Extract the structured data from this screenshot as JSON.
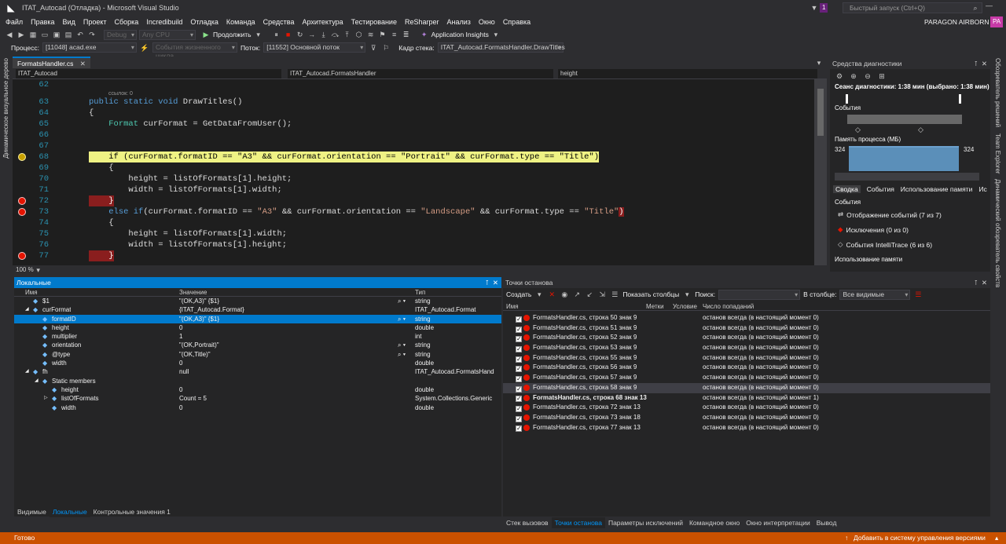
{
  "window": {
    "title": "ITAT_Autocad (Отладка) - Microsoft Visual Studio",
    "quick_launch": "Быстрый запуск (Ctrl+Q)",
    "user": "PARAGON AIRBORN",
    "user_initials": "PA",
    "notif_count": "1"
  },
  "menu": [
    "Файл",
    "Правка",
    "Вид",
    "Проект",
    "Сборка",
    "Incredibuild",
    "Отладка",
    "Команда",
    "Средства",
    "Архитектура",
    "Тестирование",
    "ReSharper",
    "Анализ",
    "Окно",
    "Справка"
  ],
  "toolbar": {
    "config": "Debug",
    "platform": "Any CPU",
    "continue": "Продолжить",
    "app_insights": "Application Insights"
  },
  "toolbar2": {
    "process_label": "Процесс:",
    "process": "[11048] acad.exe",
    "lifecycle": "События жизненного цикла",
    "thread_label": "Поток:",
    "thread": "[11552] Основной поток",
    "frame_label": "Кадр стека:",
    "frame": "ITAT_Autocad.FormatsHandler.DrawTitles"
  },
  "side_tabs": {
    "left": "Динамическое визуальное дерево",
    "right1": "Обозреватель решений",
    "right2": "Team Explorer",
    "right3": "Динамический обозреватель свойств"
  },
  "editor": {
    "tab": "FormatsHandler.cs",
    "nav_project": "ITAT_Autocad",
    "nav_class": "ITAT_Autocad.FormatsHandler",
    "nav_member": "height",
    "zoom": "100 %",
    "refs": "ссылок: 0",
    "lines": [
      {
        "n": "62",
        "code": ""
      },
      {
        "n": "63",
        "code": "public static void DrawTitles()"
      },
      {
        "n": "64",
        "code": "{"
      },
      {
        "n": "65",
        "code": "    Format curFormat = GetDataFromUser();"
      },
      {
        "n": "66",
        "code": ""
      },
      {
        "n": "67",
        "code": ""
      },
      {
        "n": "68",
        "code": "    if (curFormat.formatID == \"A3\" && curFormat.orientation == \"Portrait\" && curFormat.type == \"Title\")"
      },
      {
        "n": "69",
        "code": "    {"
      },
      {
        "n": "70",
        "code": "        height = listOfFormats[1].height;"
      },
      {
        "n": "71",
        "code": "        width = listOfFormats[1].width;"
      },
      {
        "n": "72",
        "code": "    }"
      },
      {
        "n": "73",
        "code": "    else if(curFormat.formatID == \"A3\" && curFormat.orientation == \"Landscape\" && curFormat.type == \"Title\")"
      },
      {
        "n": "74",
        "code": "    {"
      },
      {
        "n": "75",
        "code": "        height = listOfFormats[1].width;"
      },
      {
        "n": "76",
        "code": "        width = listOfFormats[1].height;"
      },
      {
        "n": "77",
        "code": "    }"
      }
    ]
  },
  "diagnostics": {
    "title": "Средства диагностики",
    "session": "Сеанс диагностики: 1:38 мин (выбрано: 1:38 мин)",
    "events": "События",
    "memory": "Память процесса (МБ)",
    "mem_left": "324",
    "mem_right": "324",
    "tabs": [
      "Сводка",
      "События",
      "Использование памяти",
      "Ис"
    ],
    "events_header": "События",
    "items": [
      "Отображение событий (7 из 7)",
      "Исключения (0 из 0)",
      "События IntelliTrace (6 из 6)"
    ],
    "memory_usage": "Использование памяти"
  },
  "locals": {
    "title": "Локальные",
    "headers": [
      "Имя",
      "Значение",
      "Тип"
    ],
    "rows": [
      {
        "name": "$1",
        "value": "\"(OK,A3)\" {$1}",
        "type": "string",
        "indent": 1
      },
      {
        "name": "curFormat",
        "value": "{ITAT_Autocad.Format}",
        "type": "ITAT_Autocad.Format",
        "indent": 1
      },
      {
        "name": "formatID",
        "value": "\"(OK,A3)\" {$1}",
        "type": "string",
        "indent": 2
      },
      {
        "name": "height",
        "value": "0",
        "type": "double",
        "indent": 2
      },
      {
        "name": "multiplier",
        "value": "1",
        "type": "int",
        "indent": 2
      },
      {
        "name": "orientation",
        "value": "\"(OK,Portrait)\"",
        "type": "string",
        "indent": 2
      },
      {
        "name": "@type",
        "value": "\"(OK,Title)\"",
        "type": "string",
        "indent": 2
      },
      {
        "name": "width",
        "value": "0",
        "type": "double",
        "indent": 2
      },
      {
        "name": "fh",
        "value": "null",
        "type": "ITAT_Autocad.FormatsHand",
        "indent": 1
      },
      {
        "name": "Static members",
        "value": "",
        "type": "",
        "indent": 2
      },
      {
        "name": "height",
        "value": "0",
        "type": "double",
        "indent": 3
      },
      {
        "name": "listOfFormats",
        "value": "Count = 5",
        "type": "System.Collections.Generic",
        "indent": 3
      },
      {
        "name": "width",
        "value": "0",
        "type": "double",
        "indent": 3
      }
    ],
    "bottom_tabs": [
      "Видимые",
      "Локальные",
      "Контрольные значения 1"
    ]
  },
  "breakpoints": {
    "title": "Точки останова",
    "create": "Создать",
    "show_columns": "Показать столбцы",
    "search": "Поиск:",
    "in_column": "В столбце:",
    "all_visible": "Все видимые",
    "headers": [
      "Имя",
      "Метки",
      "Условие",
      "Число попаданий"
    ],
    "rows": [
      {
        "name": "FormatsHandler.cs, строка 50 знак 9",
        "hits": "останов всегда  (в настоящий момент 0)"
      },
      {
        "name": "FormatsHandler.cs, строка 51 знак 9",
        "hits": "останов всегда  (в настоящий момент 0)"
      },
      {
        "name": "FormatsHandler.cs, строка 52 знак 9",
        "hits": "останов всегда  (в настоящий момент 0)"
      },
      {
        "name": "FormatsHandler.cs, строка 53 знак 9",
        "hits": "останов всегда  (в настоящий момент 0)"
      },
      {
        "name": "FormatsHandler.cs, строка 55 знак 9",
        "hits": "останов всегда  (в настоящий момент 0)"
      },
      {
        "name": "FormatsHandler.cs, строка 56 знак 9",
        "hits": "останов всегда  (в настоящий момент 0)"
      },
      {
        "name": "FormatsHandler.cs, строка 57 знак 9",
        "hits": "останов всегда  (в настоящий момент 0)"
      },
      {
        "name": "FormatsHandler.cs, строка 58 знак 9",
        "hits": "останов всегда  (в настоящий момент 0)"
      },
      {
        "name": "FormatsHandler.cs, строка 68 знак 13",
        "hits": "останов всегда  (в настоящий момент 1)"
      },
      {
        "name": "FormatsHandler.cs, строка 72 знак 13",
        "hits": "останов всегда  (в настоящий момент 0)"
      },
      {
        "name": "FormatsHandler.cs, строка 73 знак 18",
        "hits": "останов всегда  (в настоящий момент 0)"
      },
      {
        "name": "FormatsHandler.cs, строка 77 знак 13",
        "hits": "останов всегда  (в настоящий момент 0)"
      }
    ],
    "bottom_tabs": [
      "Стек вызовов",
      "Точки останова",
      "Параметры исключений",
      "Командное окно",
      "Окно интерпретации",
      "Вывод"
    ]
  },
  "status": {
    "left": "Готово",
    "right": "Добавить в систему управления версиями"
  }
}
